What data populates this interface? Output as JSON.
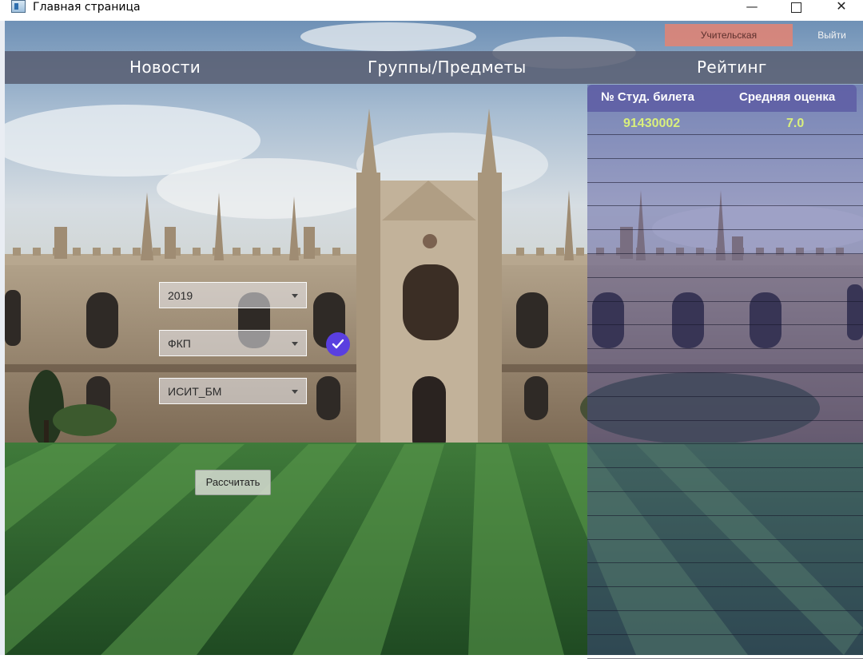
{
  "window": {
    "title": "Главная страница",
    "minimize_glyph": "—",
    "close_glyph": "✕"
  },
  "header": {
    "teacher_button": "Учительская",
    "exit_button": "Выйти"
  },
  "nav": {
    "news": "Новости",
    "groups": "Группы/Предметы",
    "rating": "Рейтинг"
  },
  "table": {
    "columns": [
      "№ Студ. билета",
      "Средняя оценка"
    ],
    "rows": [
      {
        "ticket": "91430002",
        "average": "7.0"
      }
    ]
  },
  "form": {
    "year": "2019",
    "faculty": "ФКП",
    "group": "ИСИТ_БМ",
    "calculate_button": "Рассчитать"
  },
  "colors": {
    "teacher_accent": "#d9867a",
    "check_accent": "#5a3fe0",
    "row_text": "#d9ef7c"
  },
  "icons": {
    "app": "window-app-icon",
    "check": "check-circle-icon"
  }
}
